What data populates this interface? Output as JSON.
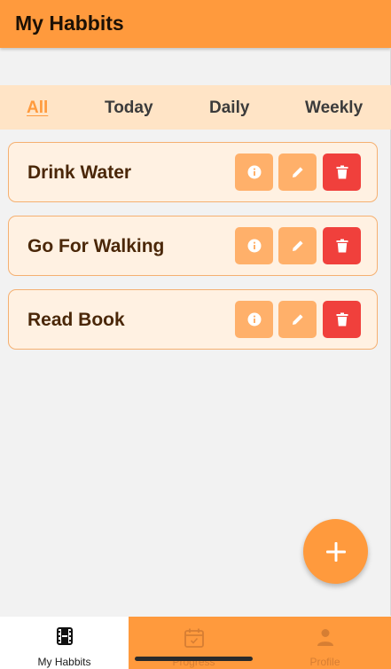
{
  "app": {
    "title": "My Habbits"
  },
  "filters": {
    "tabs": [
      {
        "label": "All",
        "active": true
      },
      {
        "label": "Today",
        "active": false
      },
      {
        "label": "Daily",
        "active": false
      },
      {
        "label": "Weekly",
        "active": false
      }
    ]
  },
  "habits": [
    {
      "name": "Drink Water"
    },
    {
      "name": "Go For Walking"
    },
    {
      "name": "Read Book"
    }
  ],
  "card_actions": [
    "info-icon",
    "pencil-icon",
    "trash-icon"
  ],
  "fab": {
    "icon": "plus-icon"
  },
  "bottom_nav": {
    "items": [
      {
        "label": "My Habbits",
        "icon": "film-icon",
        "active": true
      },
      {
        "label": "Progress",
        "icon": "calendar-check-icon",
        "active": false
      },
      {
        "label": "Profile",
        "icon": "person-icon",
        "active": false
      }
    ]
  },
  "colors": {
    "accent": "#ff9a3d",
    "filter_bar": "#ffe4c6",
    "card_bg": "#fff1e2",
    "delete": "#f0403c",
    "habit_text": "#4a2708"
  }
}
